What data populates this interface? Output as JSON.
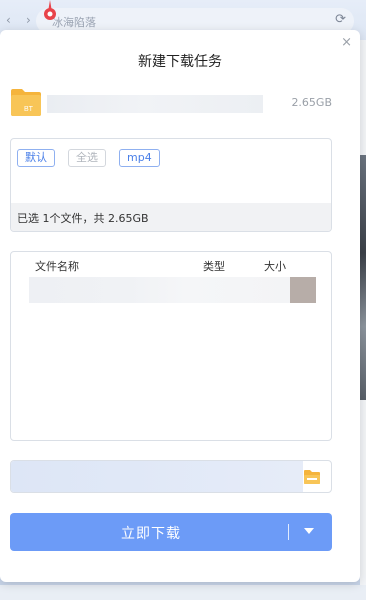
{
  "browser": {
    "url_text": "冰海陷落",
    "back_label": "‹",
    "forward_label": "›",
    "refresh_label": "⟳"
  },
  "dialog": {
    "title": "新建下载任务",
    "close_label": "×",
    "file": {
      "icon_label": "BT",
      "size": "2.65GB"
    },
    "filters": {
      "default_label": "默认",
      "select_all_label": "全选",
      "mp4_label": "mp4"
    },
    "summary": "已选 1个文件，共 2.65GB",
    "list": {
      "col_name": "文件名称",
      "col_type": "类型",
      "col_size": "大小"
    },
    "download_button": "立即下载"
  },
  "colors": {
    "accent": "#6c9bf7",
    "chip_active": "#4a7fe8",
    "folder": "#f5b43c"
  }
}
